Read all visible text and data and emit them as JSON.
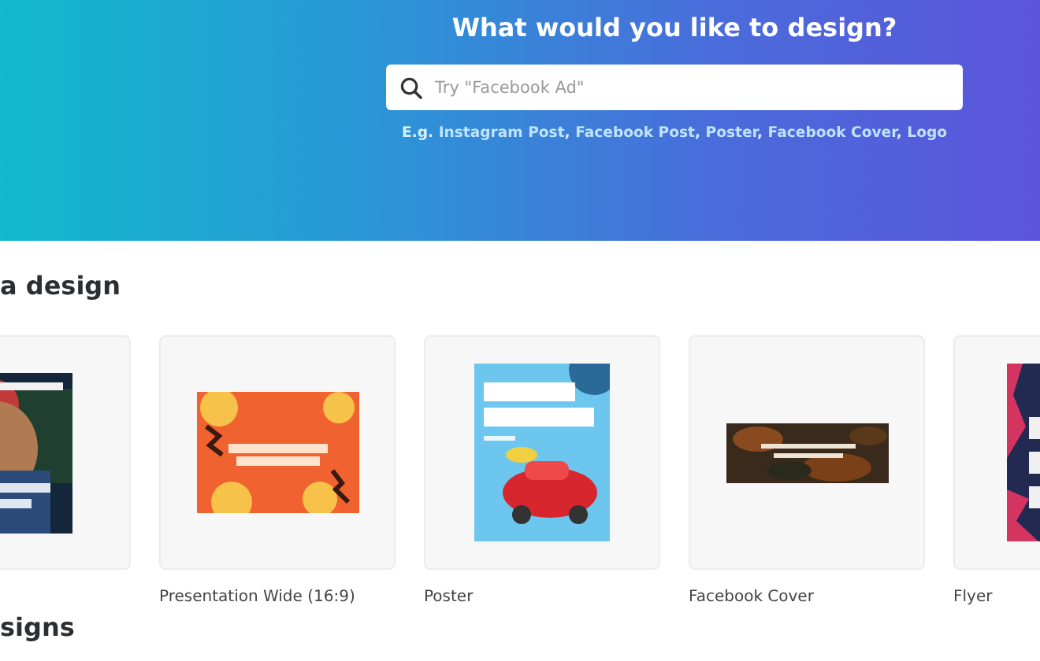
{
  "header": {
    "title": "What would you like to design?",
    "search": {
      "placeholder": "Try \"Facebook Ad\""
    },
    "examples": {
      "lead": "E.g.",
      "links": [
        "Instagram Post",
        "Facebook Post",
        "Poster",
        "Facebook Cover",
        "Logo"
      ],
      "separator": ","
    }
  },
  "section": {
    "title": "a design",
    "items": [
      {
        "kind": "picture"
      },
      {
        "kind": "picture",
        "label": "Presentation Wide (16:9)"
      },
      {
        "kind": "picture",
        "label": "Poster"
      },
      {
        "kind": "picture",
        "label": "Facebook Cover"
      },
      {
        "kind": "picture",
        "label": "Flyer"
      }
    ]
  },
  "next_section": {
    "title": "signs"
  }
}
